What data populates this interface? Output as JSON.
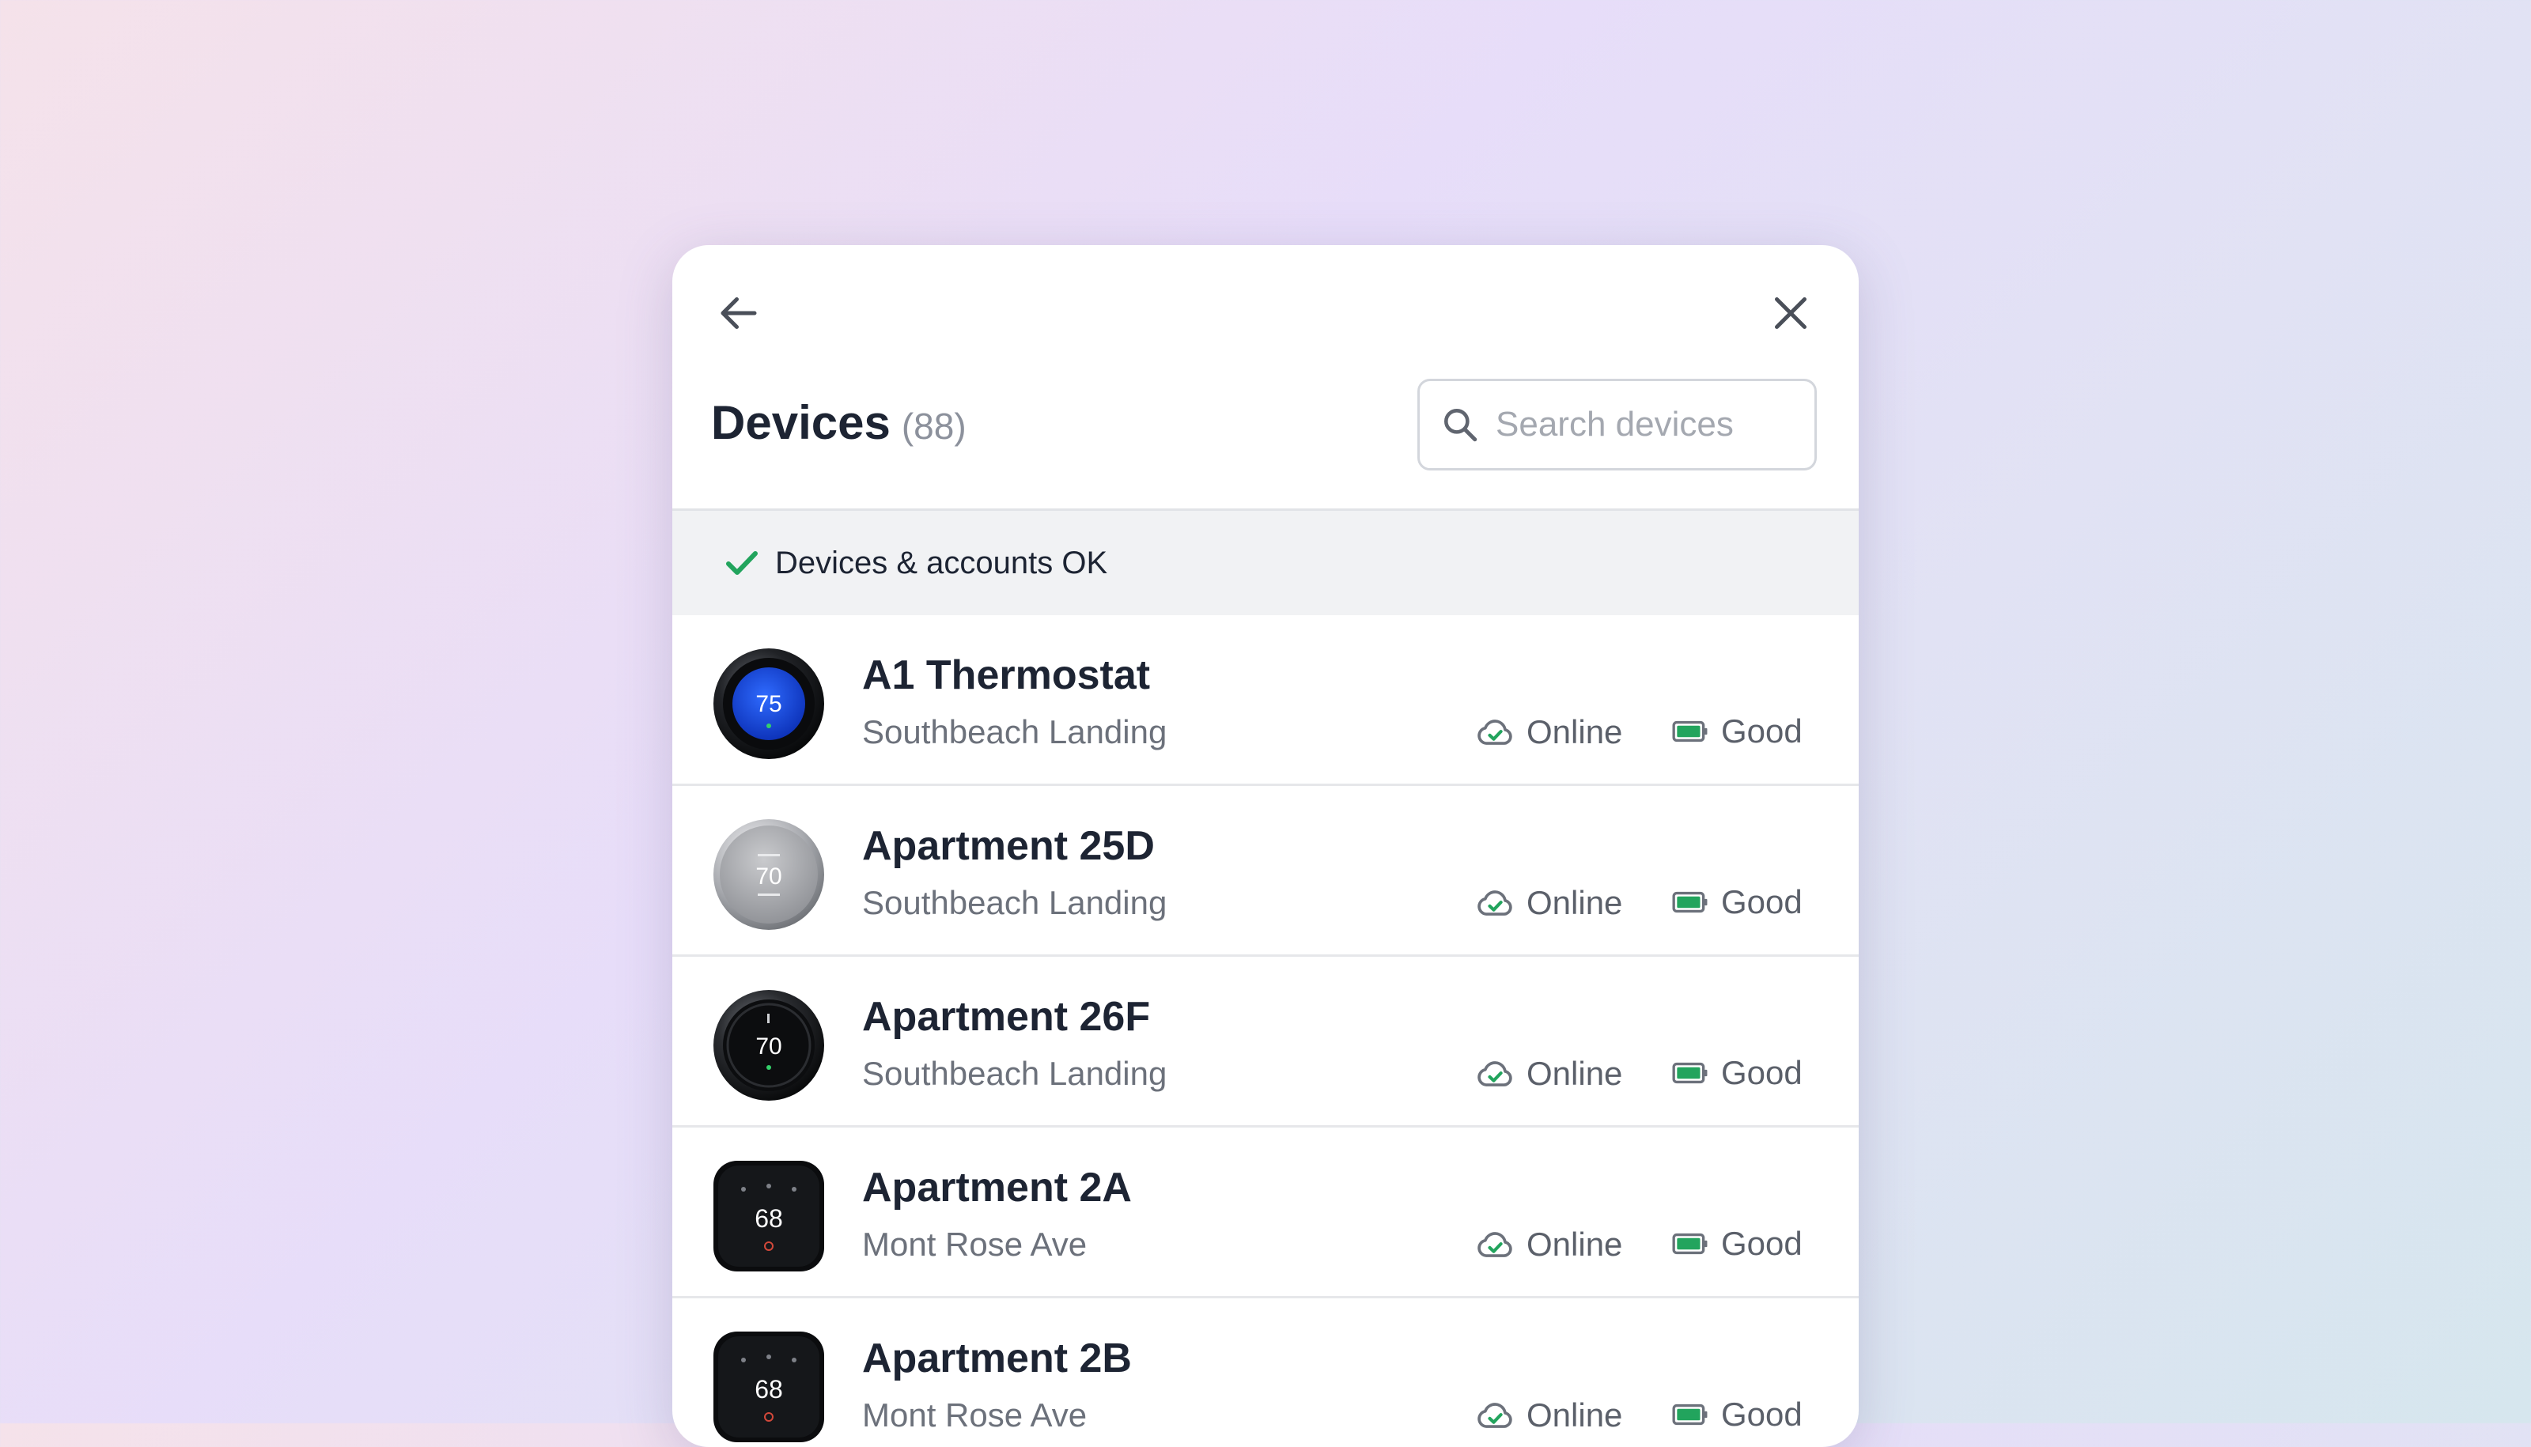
{
  "header": {
    "title": "Devices",
    "count": "(88)",
    "back_icon": "arrow-left-icon",
    "close_icon": "close-icon"
  },
  "search": {
    "placeholder": "Search devices",
    "value": "",
    "icon": "search-icon"
  },
  "status": {
    "icon": "check-icon",
    "text": "Devices & accounts OK",
    "color": "#22a45d"
  },
  "colors": {
    "accent_green": "#22a45d",
    "text_dark": "#1d2433",
    "text_muted": "#6c717b"
  },
  "devices": [
    {
      "name": "A1 Thermostat",
      "location": "Southbeach Landing",
      "connection": "Online",
      "battery": "Good",
      "thumb_style": "nest-blue",
      "display": "75"
    },
    {
      "name": "Apartment 25D",
      "location": "Southbeach Landing",
      "connection": "Online",
      "battery": "Good",
      "thumb_style": "nest-silver",
      "display": "70"
    },
    {
      "name": "Apartment 26F",
      "location": "Southbeach Landing",
      "connection": "Online",
      "battery": "Good",
      "thumb_style": "nest-dark",
      "display": "70"
    },
    {
      "name": "Apartment 2A",
      "location": "Mont Rose Ave",
      "connection": "Online",
      "battery": "Good",
      "thumb_style": "ecobee",
      "display": "68"
    },
    {
      "name": "Apartment 2B",
      "location": "Mont Rose Ave",
      "connection": "Online",
      "battery": "Good",
      "thumb_style": "ecobee",
      "display": "68"
    }
  ]
}
